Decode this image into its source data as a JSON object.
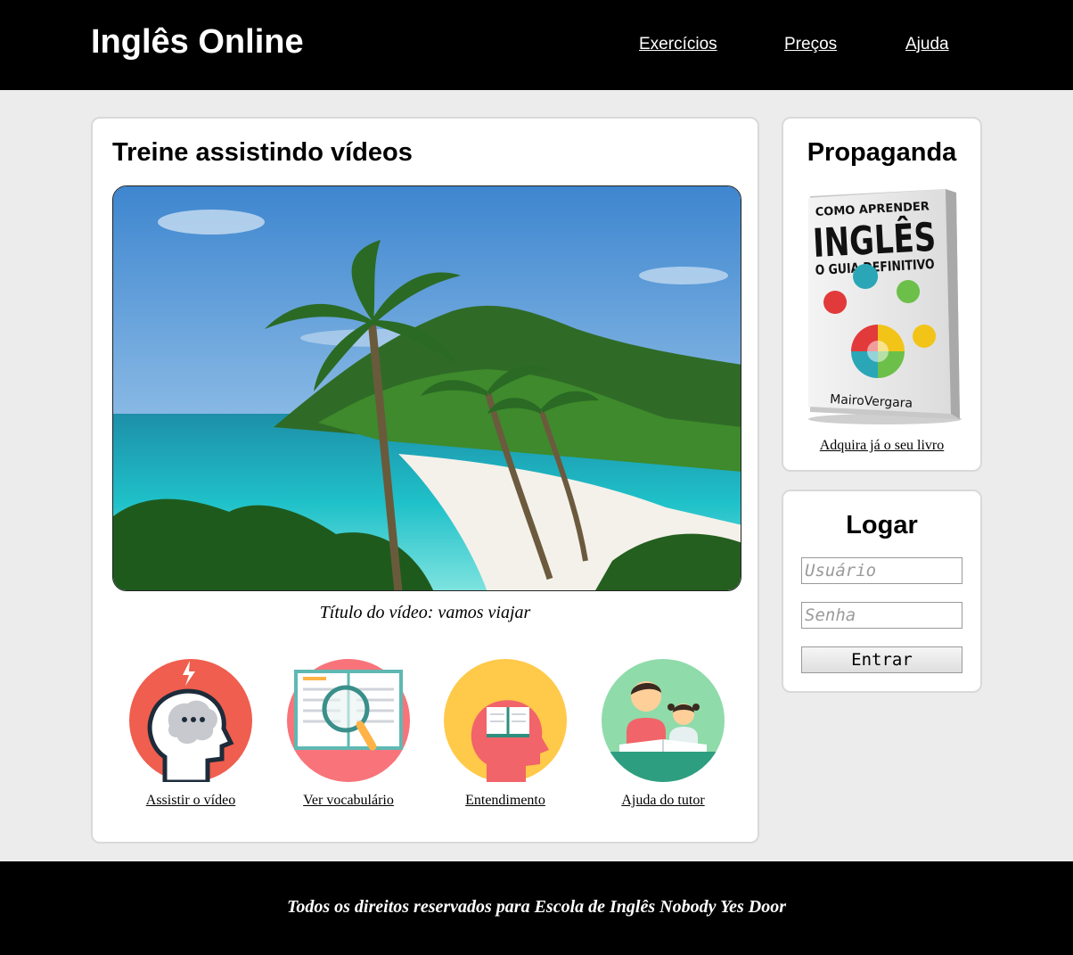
{
  "header": {
    "site_title": "Inglês Online",
    "nav": [
      "Exercícios",
      "Preços",
      "Ajuda"
    ]
  },
  "main": {
    "title": "Treine assistindo vídeos",
    "video_caption": "Título do vídeo: vamos viajar",
    "features": [
      {
        "label": "Assistir o vídeo",
        "icon": "brain-head-icon"
      },
      {
        "label": "Ver vocabulário",
        "icon": "book-magnifier-icon"
      },
      {
        "label": "Entendimento",
        "icon": "head-book-icon"
      },
      {
        "label": "Ajuda do tutor",
        "icon": "tutor-child-icon"
      }
    ]
  },
  "ad": {
    "title": "Propaganda",
    "book": {
      "line1": "COMO APRENDER",
      "line2": "INGLÊS",
      "line3": "O GUIA DEFINITIVO",
      "author": "MairoVergara"
    },
    "link": "Adquira já o seu livro"
  },
  "login": {
    "title": "Logar",
    "user_placeholder": "Usuário",
    "pass_placeholder": "Senha",
    "submit": "Entrar"
  },
  "footer": {
    "text": "Todos os direitos reservados para Escola de Inglês Nobody Yes Door"
  },
  "colors": {
    "header_bg": "#000000",
    "page_bg": "#ececec",
    "icon1_bg": "#ef5e4e",
    "icon2_bg": "#f8747a",
    "icon3_bg": "#ffc94a",
    "icon4_bg": "#8fdbaa"
  }
}
